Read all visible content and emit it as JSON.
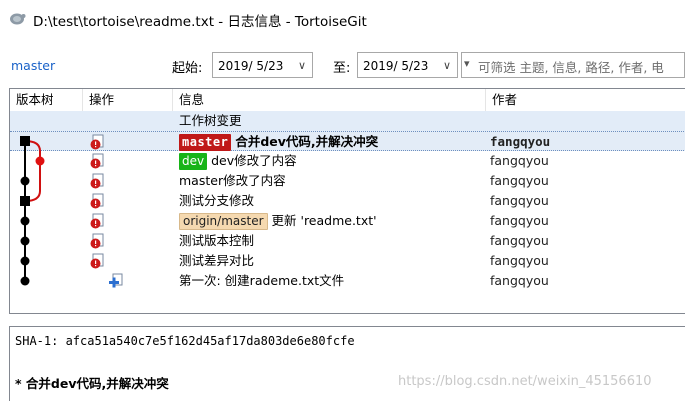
{
  "window": {
    "title": "D:\\test\\tortoise\\readme.txt - 日志信息 - TortoiseGit"
  },
  "toolbar": {
    "branch": "master",
    "from_label": "起始:",
    "from_date": "2019/  5/23",
    "to_label": "至:",
    "to_date": "2019/  5/23",
    "filter_placeholder": "可筛选 主题, 信息, 路径, 作者, 电"
  },
  "columns": [
    "版本树",
    "操作",
    "信息",
    "作者"
  ],
  "rows": [
    {
      "message": "工作树变更",
      "author": "",
      "tags": []
    },
    {
      "message": "合并dev代码,并解决冲突",
      "author": "fangqyou",
      "tags": [
        "master"
      ]
    },
    {
      "message": "dev修改了内容",
      "author": "fangqyou",
      "tags": [
        "dev"
      ]
    },
    {
      "message": "master修改了内容",
      "author": "fangqyou",
      "tags": []
    },
    {
      "message": "测试分支修改",
      "author": "fangqyou",
      "tags": []
    },
    {
      "message": "更新 'readme.txt'",
      "author": "fangqyou",
      "tags": [
        "origin/master"
      ]
    },
    {
      "message": "测试版本控制",
      "author": "fangqyou",
      "tags": []
    },
    {
      "message": "测试差异对比",
      "author": "fangqyou",
      "tags": []
    },
    {
      "message": "第一次: 创建rademe.txt文件",
      "author": "fangqyou",
      "tags": []
    }
  ],
  "details": {
    "sha": "SHA-1: afca51a540c7e5f162d45af17da803de6e80fcfe",
    "message": "* 合并dev代码,并解决冲突"
  },
  "watermark": "https://blog.csdn.net/weixin_45156610",
  "colors": {
    "master_tag": "#c01818",
    "dev_tag": "#18b418",
    "origin_tag": "#f5d9b0",
    "branch_link": "#1a62c8",
    "graph_line": "#000000",
    "graph_branch": "#d01010"
  },
  "icons": [
    "tortoise-app-icon",
    "modified-file-icon",
    "add-file-icon",
    "chevron-down-icon"
  ]
}
